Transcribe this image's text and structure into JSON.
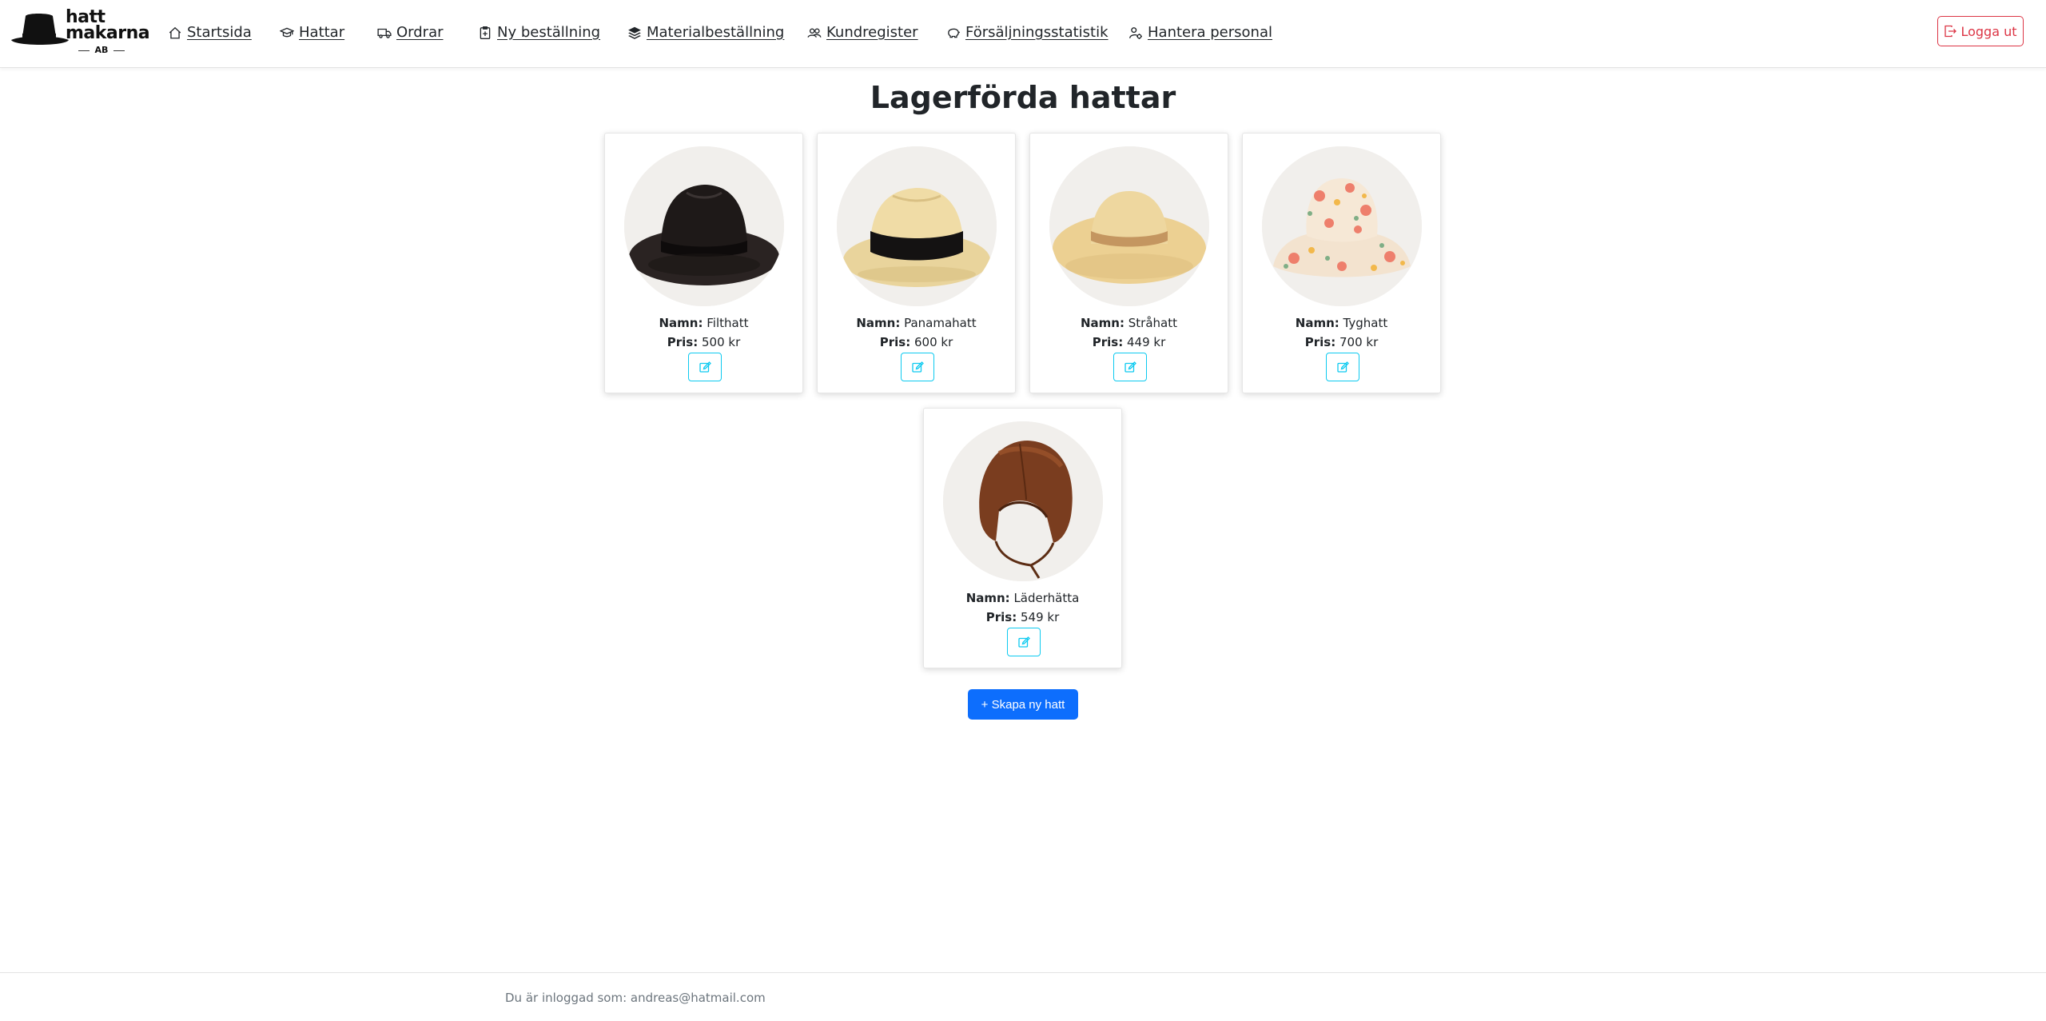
{
  "brand": {
    "line1": "hatt",
    "line2": "makarna",
    "line3": "AB"
  },
  "nav": {
    "items": [
      {
        "label": "Startsida",
        "icon": "home-icon"
      },
      {
        "label": "Hattar",
        "icon": "graduation-cap-icon"
      },
      {
        "label": "Ordrar",
        "icon": "truck-icon"
      },
      {
        "label": "Ny beställning",
        "icon": "clipboard-plus-icon"
      },
      {
        "label": "Materialbeställning",
        "icon": "layers-icon"
      },
      {
        "label": "Kundregister",
        "icon": "people-icon"
      },
      {
        "label": "Försäljningsstatistik",
        "icon": "piggy-bank-icon"
      },
      {
        "label": "Hantera personal",
        "icon": "person-gear-icon"
      }
    ],
    "logout_label": "Logga ut"
  },
  "main": {
    "title": "Lagerförda hattar",
    "name_prefix": "Namn:",
    "price_prefix": "Pris:",
    "hats": [
      {
        "name": "Filthatt",
        "price": "500 kr",
        "image": "black-fedora"
      },
      {
        "name": "Panamahatt",
        "price": "600 kr",
        "image": "straw-panama-black-band"
      },
      {
        "name": "Stråhatt",
        "price": "449 kr",
        "image": "straw-wide-brim"
      },
      {
        "name": "Tyghatt",
        "price": "700 kr",
        "image": "floral-bucket-hat"
      },
      {
        "name": "Läderhätta",
        "price": "549 kr",
        "image": "leather-aviator-cap"
      }
    ],
    "create_button_label": "+ Skapa ny hatt"
  },
  "footer": {
    "text": "Du är inloggad som: andreas@hatmail.com"
  },
  "colors": {
    "logout": "#dc3545",
    "edit": "#0dcaf0",
    "primary": "#0d6efd"
  }
}
